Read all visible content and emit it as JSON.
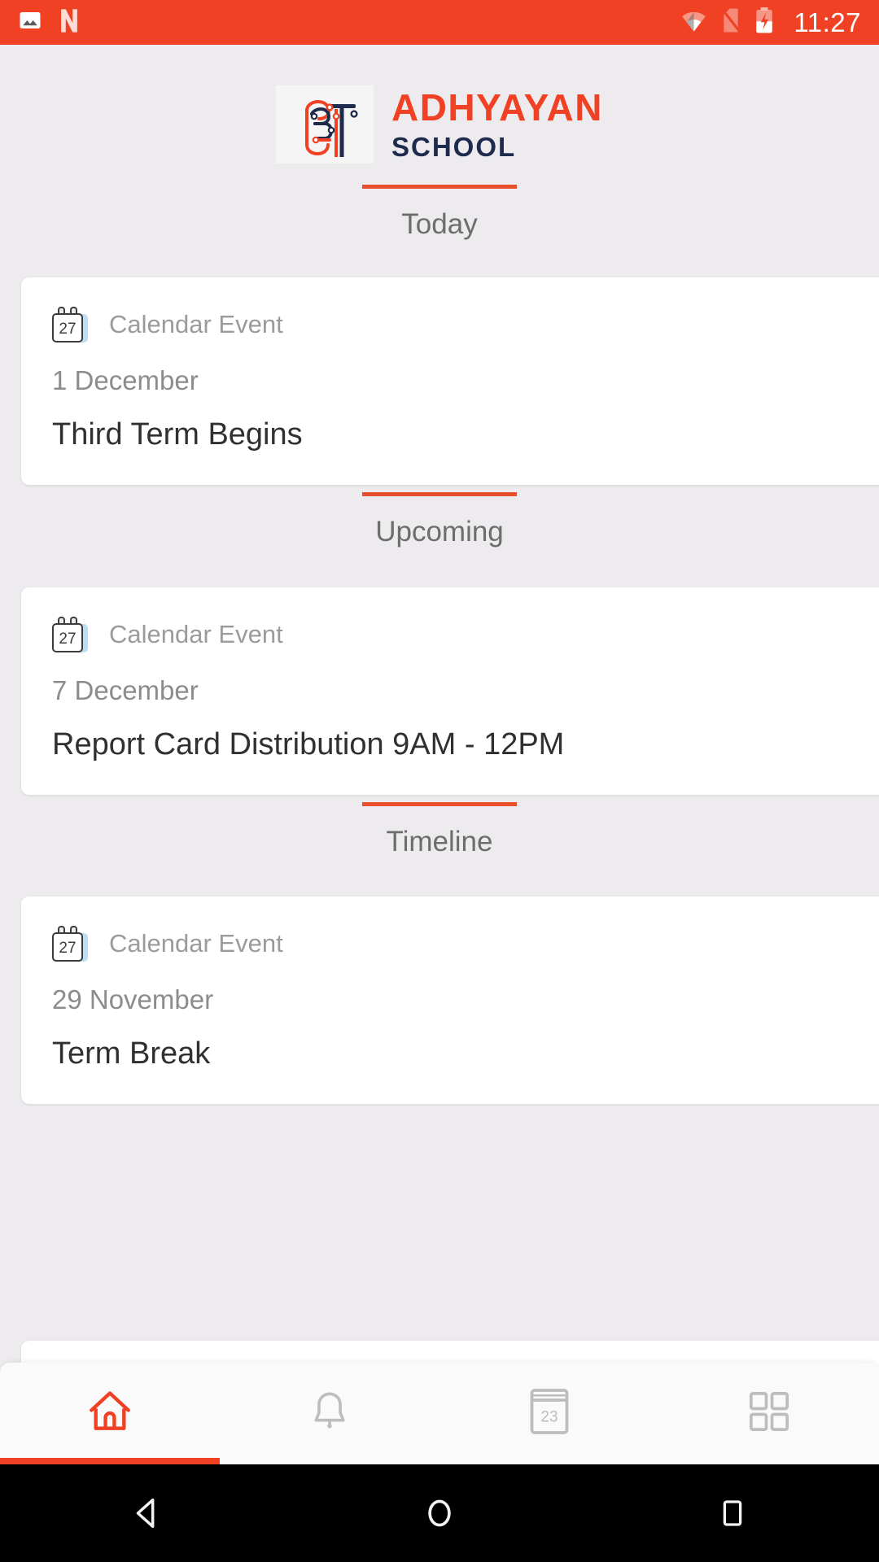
{
  "status_bar": {
    "background": "#F04124",
    "time": "11:27",
    "left_icons": [
      "gallery-icon",
      "netflix-icon"
    ],
    "right_icons": [
      "wifi-icon",
      "no-sim-icon",
      "battery-charging-icon"
    ]
  },
  "brand": {
    "mark_text": "अ",
    "name": "ADHYAYAN",
    "subtitle": "SCHOOL",
    "name_color": "#F04124",
    "subtitle_color": "#1F2B4D"
  },
  "accent_color": "#E8502B",
  "sections": [
    {
      "label": "Today",
      "card": {
        "kind": "Calendar Event",
        "icon": "calendar-event-icon",
        "icon_day": "27",
        "date": "1 December",
        "title": "Third Term Begins"
      }
    },
    {
      "label": "Upcoming",
      "card": {
        "kind": "Calendar Event",
        "icon": "calendar-event-icon",
        "icon_day": "27",
        "date": "7 December",
        "title": "Report Card Distribution 9AM - 12PM"
      }
    },
    {
      "label": "Timeline",
      "card": {
        "kind": "Calendar Event",
        "icon": "calendar-event-icon",
        "icon_day": "27",
        "date": "29 November",
        "title": "Term Break"
      }
    }
  ],
  "bottom_nav": {
    "items": [
      {
        "name": "home",
        "icon": "home-icon",
        "active": true
      },
      {
        "name": "notifications",
        "icon": "bell-icon",
        "active": false
      },
      {
        "name": "calendar",
        "icon": "calendar-icon",
        "active": false,
        "day": "23"
      },
      {
        "name": "more",
        "icon": "grid-icon",
        "active": false
      }
    ],
    "active_color": "#F04124",
    "inactive_color": "#BDBDBD"
  },
  "system_nav": {
    "buttons": [
      "back-button",
      "home-button",
      "recents-button"
    ]
  }
}
